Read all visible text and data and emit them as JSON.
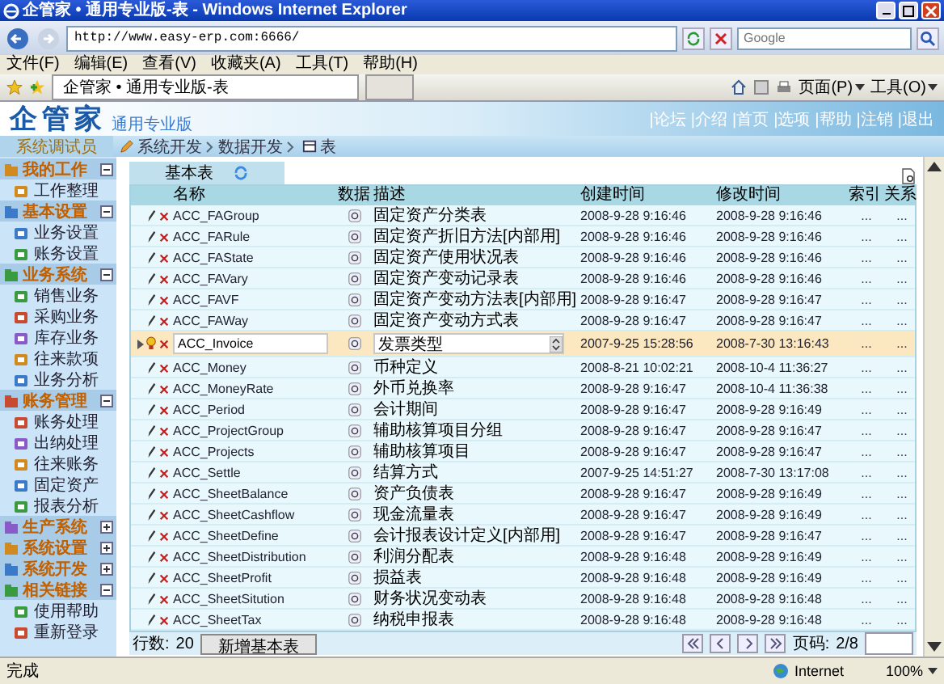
{
  "window": {
    "title": "企管家 • 通用专业版-表 - Windows Internet Explorer"
  },
  "address": {
    "url": "http://www.easy-erp.com:6666/",
    "search_placeholder": "Google"
  },
  "menu": [
    "文件(F)",
    "编辑(E)",
    "查看(V)",
    "收藏夹(A)",
    "工具(T)",
    "帮助(H)"
  ],
  "browser_tab": "企管家 • 通用专业版-表",
  "toolbar": [
    "页面(P)",
    "工具(O)"
  ],
  "app": {
    "logo": "企管家",
    "edition": "通用专业版",
    "links": [
      "|论坛",
      "|介绍",
      "|首页",
      "|选项",
      "|帮助",
      "|注销",
      "|退出"
    ],
    "user": "系统调试员",
    "breadcrumb": [
      "系统开发",
      "数据开发",
      "表"
    ]
  },
  "sidebar": [
    {
      "label": "我的工作",
      "expanded": true,
      "children": [
        "工作整理"
      ]
    },
    {
      "label": "基本设置",
      "expanded": true,
      "children": [
        "业务设置",
        "账务设置"
      ]
    },
    {
      "label": "业务系统",
      "expanded": true,
      "children": [
        "销售业务",
        "采购业务",
        "库存业务",
        "往来款项",
        "业务分析"
      ]
    },
    {
      "label": "账务管理",
      "expanded": true,
      "children": [
        "账务处理",
        "出纳处理",
        "往来账务",
        "固定资产",
        "报表分析"
      ]
    },
    {
      "label": "生产系统",
      "expanded": false
    },
    {
      "label": "系统设置",
      "expanded": false
    },
    {
      "label": "系统开发",
      "expanded": false
    },
    {
      "label": "相关链接",
      "expanded": true,
      "children": [
        "使用帮助",
        "重新登录"
      ]
    }
  ],
  "tab": "基本表",
  "columns": [
    "名称",
    "数据",
    "描述",
    "创建时间",
    "修改时间",
    "索引",
    "关系"
  ],
  "rows": [
    {
      "name": "ACC_FAGroup",
      "desc": "固定资产分类表",
      "created": "2008-9-28 9:16:46",
      "modified": "2008-9-28 9:16:46",
      "index": "...",
      "relation": "...",
      "selected": false
    },
    {
      "name": "ACC_FARule",
      "desc": "固定资产折旧方法[内部用]",
      "created": "2008-9-28 9:16:46",
      "modified": "2008-9-28 9:16:46",
      "index": "...",
      "relation": "...",
      "selected": false
    },
    {
      "name": "ACC_FAState",
      "desc": "固定资产使用状况表",
      "created": "2008-9-28 9:16:46",
      "modified": "2008-9-28 9:16:46",
      "index": "...",
      "relation": "...",
      "selected": false
    },
    {
      "name": "ACC_FAVary",
      "desc": "固定资产变动记录表",
      "created": "2008-9-28 9:16:46",
      "modified": "2008-9-28 9:16:46",
      "index": "...",
      "relation": "...",
      "selected": false
    },
    {
      "name": "ACC_FAVF",
      "desc": "固定资产变动方法表[内部用]",
      "created": "2008-9-28 9:16:47",
      "modified": "2008-9-28 9:16:47",
      "index": "...",
      "relation": "...",
      "selected": false
    },
    {
      "name": "ACC_FAWay",
      "desc": "固定资产变动方式表",
      "created": "2008-9-28 9:16:47",
      "modified": "2008-9-28 9:16:47",
      "index": "...",
      "relation": "...",
      "selected": false
    },
    {
      "name": "ACC_Invoice",
      "desc": "发票类型",
      "created": "2007-9-25 15:28:56",
      "modified": "2008-7-30 13:16:43",
      "index": "...",
      "relation": "...",
      "selected": true
    },
    {
      "name": "ACC_Money",
      "desc": "币种定义",
      "created": "2008-8-21 10:02:21",
      "modified": "2008-10-4 11:36:27",
      "index": "...",
      "relation": "...",
      "selected": false
    },
    {
      "name": "ACC_MoneyRate",
      "desc": "外币兑换率",
      "created": "2008-9-28 9:16:47",
      "modified": "2008-10-4 11:36:38",
      "index": "...",
      "relation": "...",
      "selected": false
    },
    {
      "name": "ACC_Period",
      "desc": "会计期间",
      "created": "2008-9-28 9:16:47",
      "modified": "2008-9-28 9:16:49",
      "index": "...",
      "relation": "...",
      "selected": false
    },
    {
      "name": "ACC_ProjectGroup",
      "desc": "辅助核算项目分组",
      "created": "2008-9-28 9:16:47",
      "modified": "2008-9-28 9:16:47",
      "index": "...",
      "relation": "...",
      "selected": false
    },
    {
      "name": "ACC_Projects",
      "desc": "辅助核算项目",
      "created": "2008-9-28 9:16:47",
      "modified": "2008-9-28 9:16:47",
      "index": "...",
      "relation": "...",
      "selected": false
    },
    {
      "name": "ACC_Settle",
      "desc": "结算方式",
      "created": "2007-9-25 14:51:27",
      "modified": "2008-7-30 13:17:08",
      "index": "...",
      "relation": "...",
      "selected": false
    },
    {
      "name": "ACC_SheetBalance",
      "desc": "资产负债表",
      "created": "2008-9-28 9:16:47",
      "modified": "2008-9-28 9:16:49",
      "index": "...",
      "relation": "...",
      "selected": false
    },
    {
      "name": "ACC_SheetCashflow",
      "desc": "现金流量表",
      "created": "2008-9-28 9:16:47",
      "modified": "2008-9-28 9:16:49",
      "index": "...",
      "relation": "...",
      "selected": false
    },
    {
      "name": "ACC_SheetDefine",
      "desc": "会计报表设计定义[内部用]",
      "created": "2008-9-28 9:16:47",
      "modified": "2008-9-28 9:16:47",
      "index": "...",
      "relation": "...",
      "selected": false
    },
    {
      "name": "ACC_SheetDistribution",
      "desc": "利润分配表",
      "created": "2008-9-28 9:16:48",
      "modified": "2008-9-28 9:16:49",
      "index": "...",
      "relation": "...",
      "selected": false
    },
    {
      "name": "ACC_SheetProfit",
      "desc": "损益表",
      "created": "2008-9-28 9:16:48",
      "modified": "2008-9-28 9:16:49",
      "index": "...",
      "relation": "...",
      "selected": false
    },
    {
      "name": "ACC_SheetSitution",
      "desc": "财务状况变动表",
      "created": "2008-9-28 9:16:48",
      "modified": "2008-9-28 9:16:48",
      "index": "...",
      "relation": "...",
      "selected": false
    },
    {
      "name": "ACC_SheetTax",
      "desc": "纳税申报表",
      "created": "2008-9-28 9:16:48",
      "modified": "2008-9-28 9:16:48",
      "index": "...",
      "relation": "...",
      "selected": false
    }
  ],
  "footer": {
    "rows_label": "行数:",
    "rows_count": "20",
    "add_button": "新增基本表",
    "page_label": "页码:",
    "page": "2/8"
  },
  "status_bar": {
    "text": "完成",
    "zone": "Internet",
    "zoom": "100%"
  }
}
